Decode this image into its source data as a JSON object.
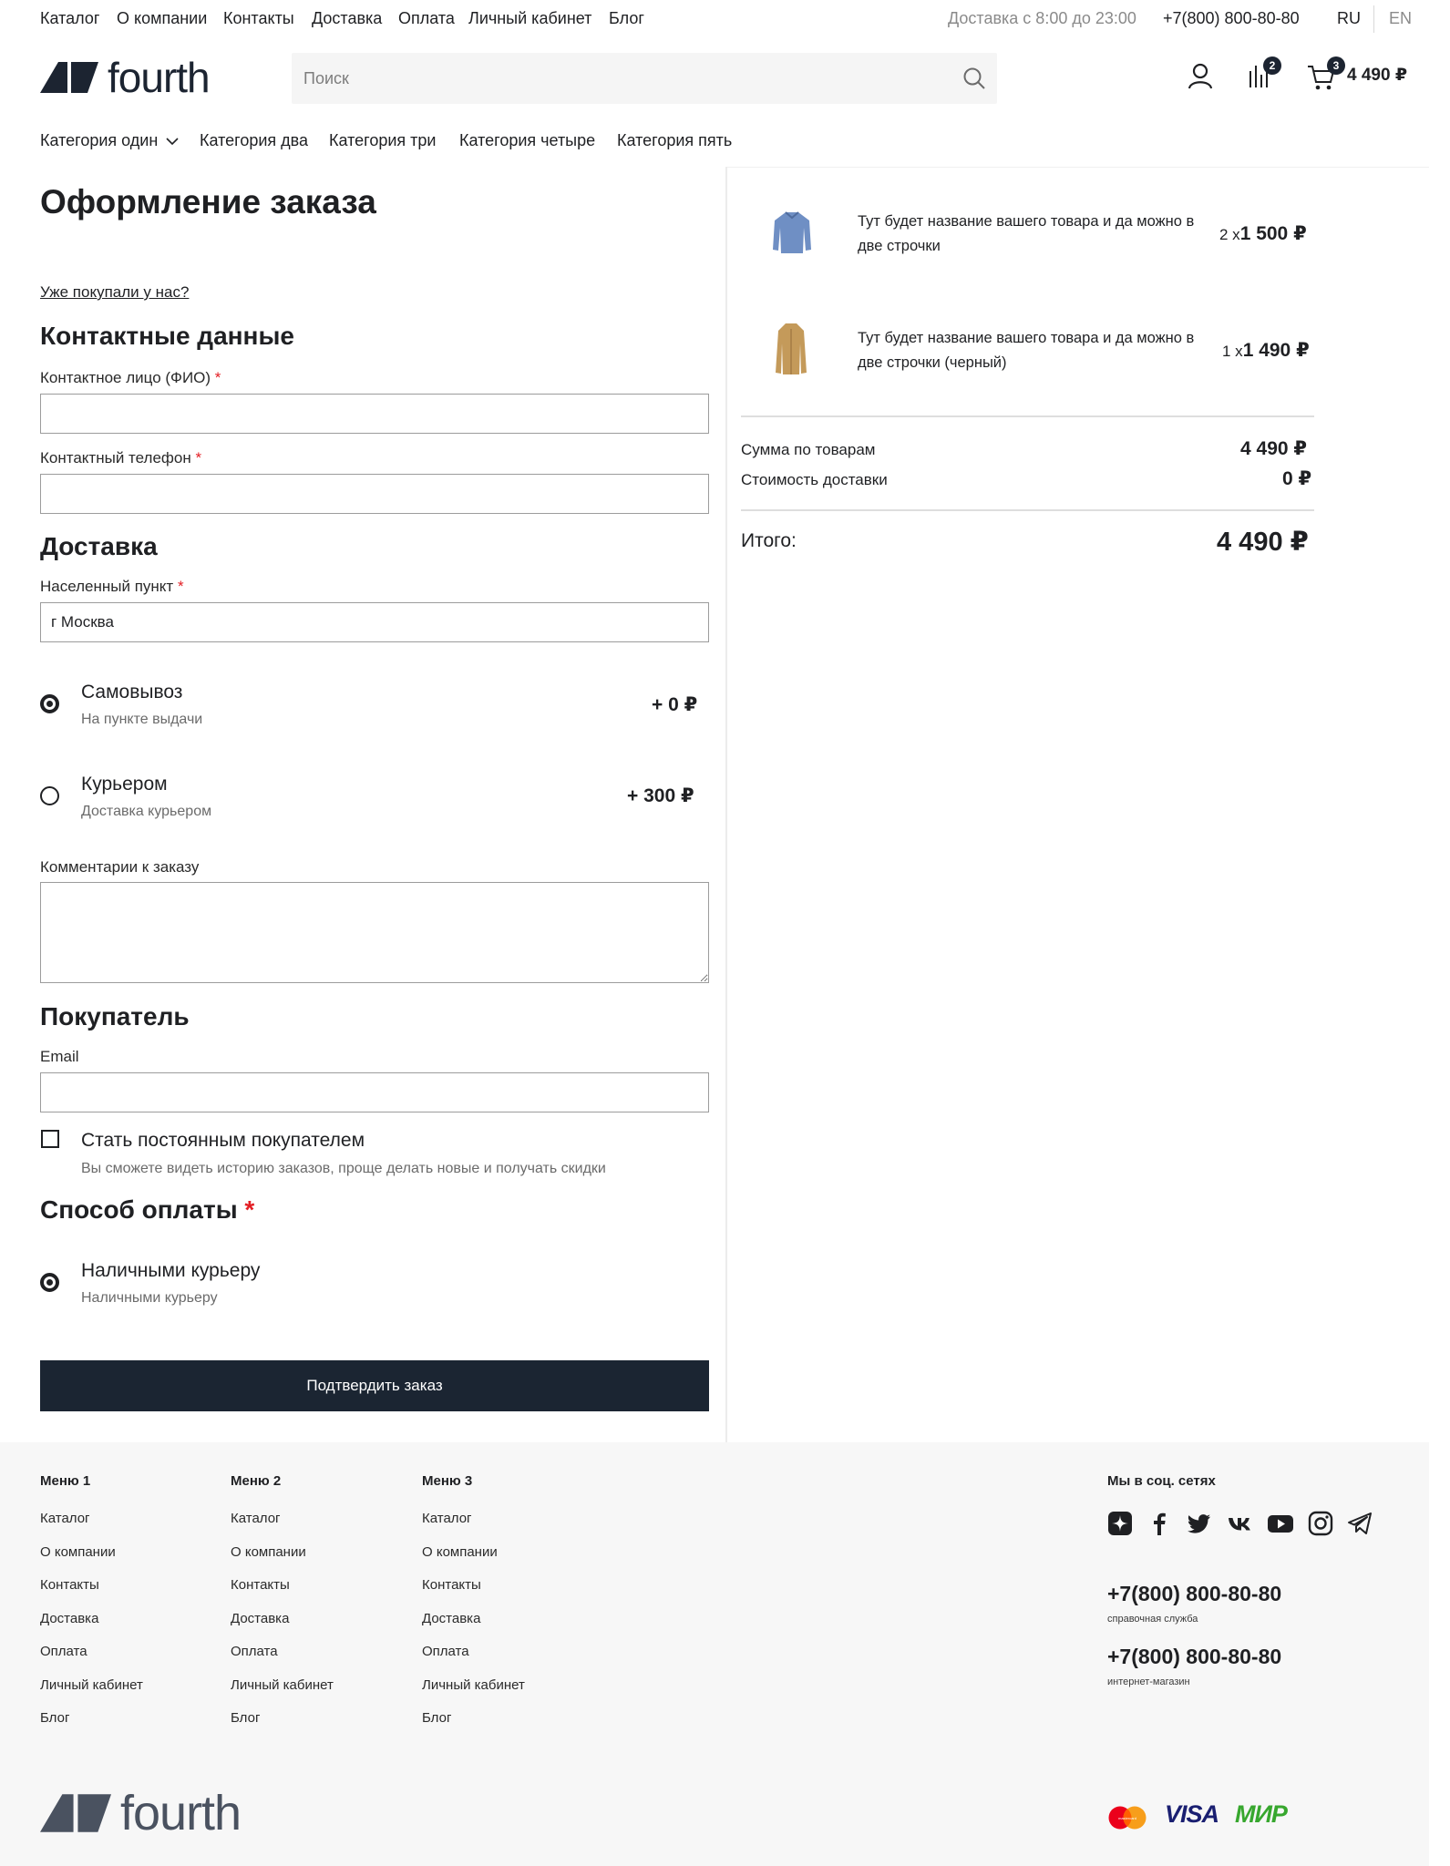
{
  "topnav": {
    "links": [
      "Каталог",
      "О компании",
      "Контакты",
      "Доставка",
      "Оплата",
      "Личный кабинет",
      "Блог"
    ],
    "delivery_hours": "Доставка с 8:00 до 23:00",
    "phone": "+7(800) 800-80-80",
    "lang_ru": "RU",
    "lang_en": "EN"
  },
  "header": {
    "logo_text": "fourth",
    "search_placeholder": "Поиск",
    "compare_count": "2",
    "cart_count": "3",
    "cart_total": "4 490 ₽"
  },
  "categories": [
    "Категория один",
    "Категория два",
    "Категория три",
    "Категория четыре",
    "Категория пять"
  ],
  "checkout": {
    "title": "Оформление заказа",
    "returning_link": "Уже покупали у нас?",
    "contacts_heading": "Контактные данные",
    "contact_name_label": "Контактное лицо (ФИО)",
    "contact_name_value": "",
    "phone_label": "Контактный телефон",
    "phone_value": "",
    "delivery_heading": "Доставка",
    "city_label": "Населенный пункт",
    "city_value": "г Москва",
    "delivery_options": [
      {
        "title": "Самовывоз",
        "subtitle": "На пункте выдачи",
        "price": "+ 0 ₽",
        "selected": true
      },
      {
        "title": "Курьером",
        "subtitle": "Доставка курьером",
        "price": "+ 300 ₽",
        "selected": false
      }
    ],
    "comment_label": "Комментарии к заказу",
    "comment_value": "",
    "buyer_heading": "Покупатель",
    "email_label": "Email",
    "email_value": "",
    "regular_title": "Стать постоянным покупателем",
    "regular_subtitle": "Вы сможете видеть историю заказов, проще делать новые и получать скидки",
    "regular_checked": false,
    "payment_heading": "Способ оплаты",
    "payment_options": [
      {
        "title": "Наличными курьеру",
        "subtitle": "Наличными курьеру",
        "selected": true
      }
    ],
    "submit_label": "Подтвердить заказ"
  },
  "order_summary": {
    "items": [
      {
        "name": "Тут будет название вашего товара и да можно в две строчки",
        "qty": "2 x",
        "price": "1 500 ₽"
      },
      {
        "name": "Тут будет название вашего товара и да можно в две строчки (черный)",
        "qty": "1 x",
        "price": "1 490 ₽"
      }
    ],
    "subtotal_label": "Сумма по товарам",
    "subtotal_value": "4 490 ₽",
    "shipping_label": "Стоимость доставки",
    "shipping_value": "0 ₽",
    "total_label": "Итого:",
    "total_value": "4 490 ₽"
  },
  "footer": {
    "menus": [
      {
        "title": "Меню 1",
        "links": [
          "Каталог",
          "О компании",
          "Контакты",
          "Доставка",
          "Оплата",
          "Личный кабинет",
          "Блог"
        ]
      },
      {
        "title": "Меню 2",
        "links": [
          "Каталог",
          "О компании",
          "Контакты",
          "Доставка",
          "Оплата",
          "Личный кабинет",
          "Блог"
        ]
      },
      {
        "title": "Меню 3",
        "links": [
          "Каталог",
          "О компании",
          "Контакты",
          "Доставка",
          "Оплата",
          "Личный кабинет",
          "Блог"
        ]
      }
    ],
    "social_title": "Мы в соц. сетях",
    "social_icons": [
      "yandex-zen-icon",
      "facebook-icon",
      "twitter-icon",
      "vk-icon",
      "youtube-icon",
      "instagram-icon",
      "telegram-icon"
    ],
    "phone1": "+7(800) 800-80-80",
    "phone1_note": "справочная служба",
    "phone2": "+7(800) 800-80-80",
    "phone2_note": "интернет-магазин",
    "logo_text": "fourth",
    "payment_marks": {
      "mastercard_text": "mastercard",
      "visa": "VISA",
      "mir": "МИР"
    }
  },
  "colors": {
    "brand_dark": "#1b2532",
    "required": "#e31e24",
    "footer_bg": "#f7f7f7",
    "mir_green": "#37a72e",
    "visa_blue": "#1a1f71"
  }
}
